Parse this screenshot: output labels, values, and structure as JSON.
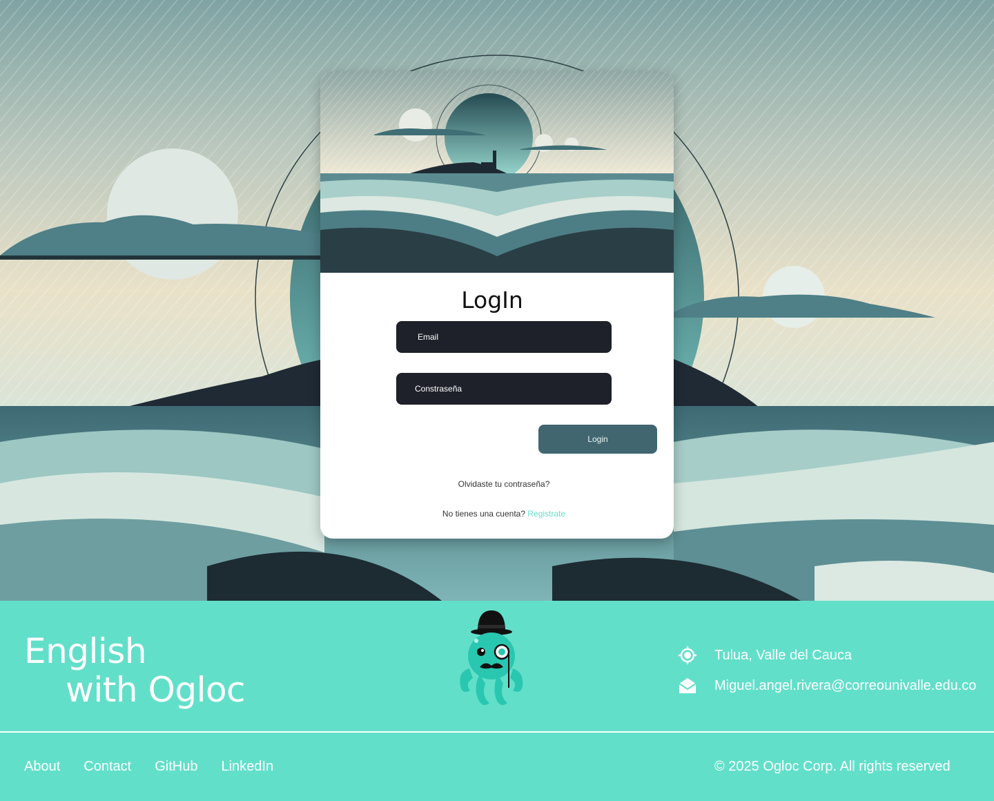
{
  "login": {
    "title": "LogIn",
    "email_placeholder": "Email",
    "password_placeholder": "Constraseña",
    "login_button": "Login",
    "forgot_password": "Olvidaste tu contraseña?",
    "no_account_text": "No tienes una cuenta?",
    "register_link": "Registrate"
  },
  "footer": {
    "brand_line1": "English",
    "brand_line2": "with Ogloc",
    "location": "Tulua, Valle del Cauca",
    "email": "Miguel.angel.rivera@correounivalle.edu.co",
    "nav": [
      "About",
      "Contact",
      "GitHub",
      "LinkedIn"
    ],
    "copyright": "© 2025 Ogloc Corp. All rights reserved"
  },
  "colors": {
    "accent": "#62dfc9",
    "input_bg": "#1e2129",
    "button_bg": "#416670"
  },
  "icons": {
    "location": "location-target-icon",
    "email": "envelope-icon",
    "mascot": "octopus-mascot-icon"
  }
}
